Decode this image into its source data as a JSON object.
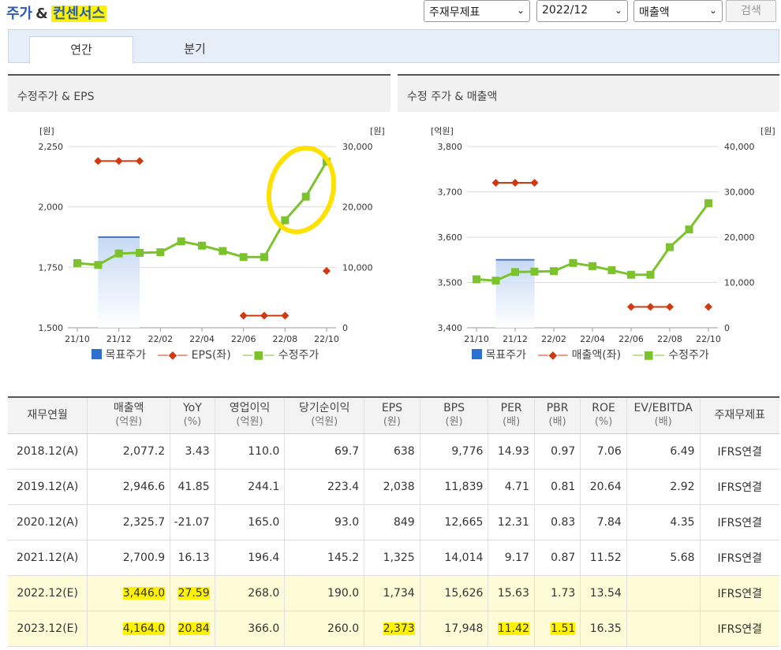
{
  "header": {
    "title_part1": "주가",
    "title_amp": "&",
    "title_part2": "컨센서스",
    "select1": "주재무제표",
    "select2": "2022/12",
    "select3": "매출액",
    "search_label": "검색"
  },
  "tabs": [
    {
      "label": "연간"
    },
    {
      "label": "분기"
    }
  ],
  "left_chart": {
    "title": "수정주가 & EPS",
    "left_unit": "[원]",
    "right_unit": "[원]",
    "legend": [
      "목표주가",
      "EPS(좌)",
      "수정주가"
    ]
  },
  "right_chart": {
    "title": "수정 주가 & 매출액",
    "left_unit": "[억원]",
    "right_unit": "[원]",
    "legend": [
      "목표주가",
      "매출액(좌)",
      "수정주가"
    ]
  },
  "chart_data": [
    {
      "type": "line",
      "title": "수정주가 & EPS",
      "x_ticks": [
        "21/10",
        "21/12",
        "22/02",
        "22/04",
        "22/06",
        "22/08",
        "22/10"
      ],
      "y_left_ticks": [
        "1,500",
        "1,750",
        "2,000",
        "2,250"
      ],
      "ylim_left": [
        1500,
        2250
      ],
      "y_right_ticks": [
        "0",
        "10,000",
        "20,000",
        "30,000"
      ],
      "ylim_right": [
        0,
        30000
      ],
      "series": [
        {
          "name": "수정주가",
          "axis": "right",
          "color": "#7cc22d",
          "values": [
            10700,
            10400,
            12300,
            12400,
            12500,
            14300,
            13600,
            12700,
            11700,
            11700,
            17800,
            21700,
            27500
          ]
        },
        {
          "name": "EPS(좌)",
          "axis": "left",
          "color": "#d03a10",
          "segments": [
            {
              "idx": [
                1,
                2,
                3
              ],
              "value": 2190
            },
            {
              "idx": [
                8,
                9,
                10
              ],
              "value": 1550
            },
            {
              "idx": [
                12
              ],
              "value": 1735
            }
          ]
        },
        {
          "name": "목표주가",
          "axis": "right",
          "color": "#4a78c9",
          "idx": [
            1,
            3
          ],
          "value": 15000
        }
      ]
    },
    {
      "type": "line",
      "title": "수정 주가 & 매출액",
      "x_ticks": [
        "21/10",
        "21/12",
        "22/02",
        "22/04",
        "22/06",
        "22/08",
        "22/10"
      ],
      "y_left_ticks": [
        "3,400",
        "3,500",
        "3,600",
        "3,700",
        "3,800"
      ],
      "ylim_left": [
        3400,
        3800
      ],
      "y_right_ticks": [
        "0",
        "10,000",
        "20,000",
        "30,000",
        "40,000"
      ],
      "ylim_right": [
        0,
        40000
      ],
      "series": [
        {
          "name": "수정주가",
          "axis": "right",
          "color": "#7cc22d",
          "values": [
            10700,
            10400,
            12300,
            12400,
            12500,
            14300,
            13600,
            12700,
            11700,
            11700,
            17800,
            21700,
            27500
          ]
        },
        {
          "name": "매출액(좌)",
          "axis": "left",
          "color": "#d03a10",
          "segments": [
            {
              "idx": [
                1,
                2,
                3
              ],
              "value": 3720
            },
            {
              "idx": [
                8,
                9,
                10
              ],
              "value": 3446
            },
            {
              "idx": [
                12
              ],
              "value": 3446
            }
          ]
        },
        {
          "name": "목표주가",
          "axis": "right",
          "color": "#4a78c9",
          "idx": [
            1,
            3
          ],
          "value": 15000
        }
      ]
    }
  ],
  "table": {
    "headers": [
      [
        "재무연월",
        ""
      ],
      [
        "매출액",
        "(억원)"
      ],
      [
        "YoY",
        "(%)"
      ],
      [
        "영업이익",
        "(억원)"
      ],
      [
        "당기순이익",
        "(억원)"
      ],
      [
        "EPS",
        "(원)"
      ],
      [
        "BPS",
        "(원)"
      ],
      [
        "PER",
        "(배)"
      ],
      [
        "PBR",
        "(배)"
      ],
      [
        "ROE",
        "(%)"
      ],
      [
        "EV/EBITDA",
        "(배)"
      ],
      [
        "주재무제표",
        ""
      ]
    ],
    "rows": [
      [
        "2018.12(A)",
        "2,077.2",
        "3.43",
        "110.0",
        "69.7",
        "638",
        "9,776",
        "14.93",
        "0.97",
        "7.06",
        "6.49",
        "IFRS연결"
      ],
      [
        "2019.12(A)",
        "2,946.6",
        "41.85",
        "244.1",
        "223.4",
        "2,038",
        "11,839",
        "4.71",
        "0.81",
        "20.64",
        "2.92",
        "IFRS연결"
      ],
      [
        "2020.12(A)",
        "2,325.7",
        "-21.07",
        "165.0",
        "93.0",
        "849",
        "12,665",
        "12.31",
        "0.83",
        "7.84",
        "4.35",
        "IFRS연결"
      ],
      [
        "2021.12(A)",
        "2,700.9",
        "16.13",
        "196.4",
        "145.2",
        "1,325",
        "14,014",
        "9.17",
        "0.87",
        "11.52",
        "5.68",
        "IFRS연결"
      ],
      [
        "2022.12(E)",
        "3,446.0",
        "27.59",
        "268.0",
        "190.0",
        "1,734",
        "15,626",
        "15.63",
        "1.73",
        "13.54",
        "",
        "IFRS연결"
      ],
      [
        "2023.12(E)",
        "4,164.0",
        "20.84",
        "366.0",
        "260.0",
        "2,373",
        "17,948",
        "11.42",
        "1.51",
        "16.35",
        "",
        "IFRS연결"
      ]
    ]
  }
}
